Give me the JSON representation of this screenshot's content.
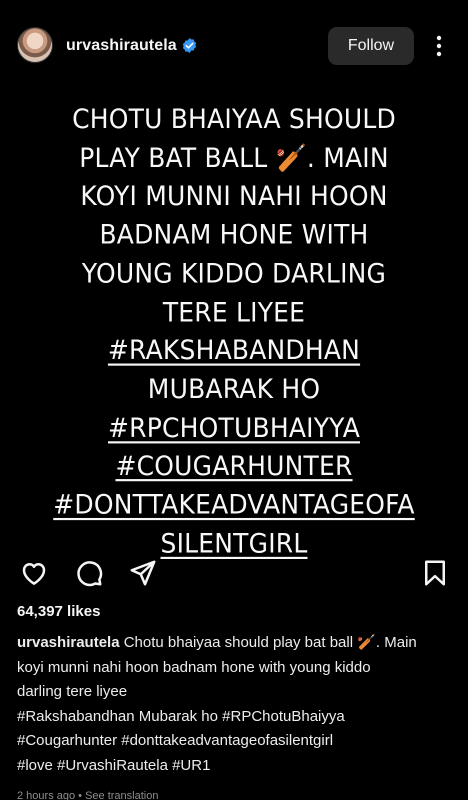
{
  "header": {
    "username": "urvashirautela",
    "follow_label": "Follow",
    "verified_icon": "verified-badge-icon",
    "more_icon": "more-vertical-icon"
  },
  "post": {
    "text_lines": [
      "CHOTU BHAIYAA SHOULD",
      "PLAY BAT BALL 🏏. MAIN",
      "KOYI MUNNI NAHI HOON",
      "BADNAM HONE WITH",
      "YOUNG KIDDO DARLING",
      "TERE LIYEE",
      "#RAKSHABANDHAN",
      "MUBARAK HO",
      "#RPCHOTUBHAIYYA",
      "#COUGARHUNTER",
      "#DONTTAKEADVANTAGEOFA",
      "SILENTGIRL"
    ]
  },
  "actions": {
    "like_icon": "heart-icon",
    "comment_icon": "comment-icon",
    "share_icon": "send-icon",
    "save_icon": "bookmark-icon"
  },
  "likes": "64,397 likes",
  "caption": {
    "username": "urvashirautela",
    "line1": "Chotu bhaiyaa should play bat ball 🏏. Main",
    "line2": "koyi munni nahi hoon badnam hone with young kiddo",
    "line3": "darling tere liyee",
    "line4": " #Rakshabandhan Mubarak ho #RPChotuBhaiyya",
    "line5": "#Cougarhunter #donttakeadvantageofasilentgirl",
    "line6": "#love #UrvashiRautela #UR1"
  },
  "meta": {
    "time": "2 hours ago",
    "separator": " • ",
    "see_translation": "See translation"
  },
  "colors": {
    "background": "#000000",
    "verified_blue": "#3897f0",
    "follow_bg": "#2a2a2a"
  }
}
